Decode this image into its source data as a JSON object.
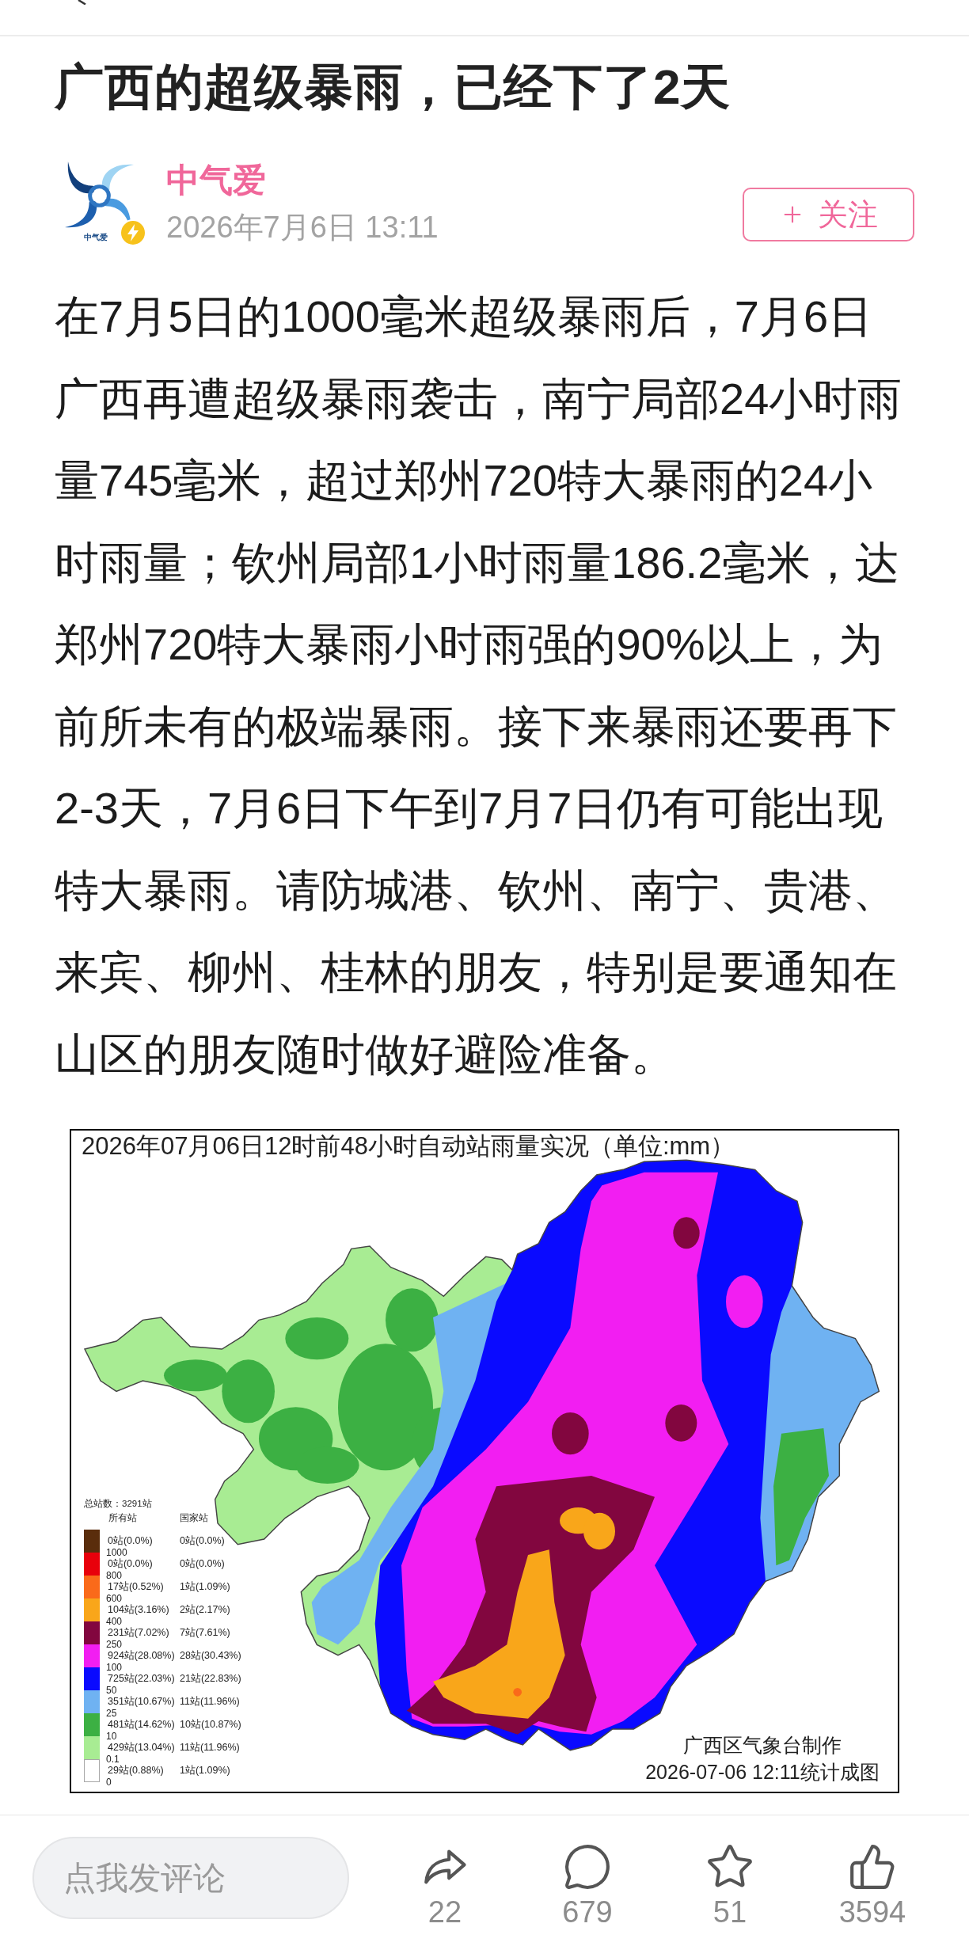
{
  "article": {
    "title": "广西的超级暴雨，已经下了2天"
  },
  "author": {
    "name": "中气爱",
    "logo_text": "中气爱",
    "verified": true,
    "time": "2026年7月6日 13:11",
    "follow_button": {
      "label": "关注",
      "followed": false
    }
  },
  "body": "在7月5日的1000毫米超级暴雨后，7月6日广西再遭超级暴雨袭击，南宁局部24小时雨量745毫米，超过郑州720特大暴雨的24小时雨量；钦州局部1小时雨量186.2毫米，达郑州720特大暴雨小时雨强的90%以上，为前所未有的极端暴雨。接下来暴雨还要再下2-3天，7月6日下午到7月7日仍有可能出现特大暴雨。请防城港、钦州、南宁、贵港、来宾、柳州、桂林的朋友，特别是要通知在山区的朋友随时做好避险准备。",
  "map": {
    "title": "2026年07月06日12时前48小时自动站雨量实况（单位:mm）",
    "legend": {
      "total": "总站数：3291站",
      "column_all": "所有站",
      "column_national": "国家站",
      "items": [
        {
          "color": "#5a2d0c",
          "all": "0站(0.0%)",
          "national": "0站(0.0%)",
          "bound": "1000"
        },
        {
          "color": "#e8000b",
          "all": "0站(0.0%)",
          "national": "0站(0.0%)",
          "bound": "800"
        },
        {
          "color": "#fa6a1a",
          "all": "17站(0.52%)",
          "national": "1站(1.09%)",
          "bound": "600"
        },
        {
          "color": "#f9a61a",
          "all": "104站(3.16%)",
          "national": "2站(2.17%)",
          "bound": "400"
        },
        {
          "color": "#82063f",
          "all": "231站(7.02%)",
          "national": "7站(7.61%)",
          "bound": "250"
        },
        {
          "color": "#f21ef2",
          "all": "924站(28.08%)",
          "national": "28站(30.43%)",
          "bound": "100"
        },
        {
          "color": "#0a0aff",
          "all": "725站(22.03%)",
          "national": "21站(22.83%)",
          "bound": "50"
        },
        {
          "color": "#6fb2f2",
          "all": "351站(10.67%)",
          "national": "11站(11.96%)",
          "bound": "25"
        },
        {
          "color": "#3cb043",
          "all": "481站(14.62%)",
          "national": "10站(10.87%)",
          "bound": "10"
        },
        {
          "color": "#a8ec93",
          "all": "429站(13.04%)",
          "national": "11站(11.96%)",
          "bound": "0.1"
        },
        {
          "color": "#ffffff",
          "all": "29站(0.88%)",
          "national": "1站(1.09%)",
          "bound": "0"
        }
      ]
    },
    "credit": [
      "广西区气象台制作",
      "2026-07-06 12:11统计成图"
    ]
  },
  "comment_box": {
    "placeholder": "点我发评论"
  },
  "actions": [
    {
      "kind": "share",
      "count": "22"
    },
    {
      "kind": "comment",
      "count": "679"
    },
    {
      "kind": "favorite",
      "count": "51"
    },
    {
      "kind": "like",
      "count": "3594"
    }
  ]
}
